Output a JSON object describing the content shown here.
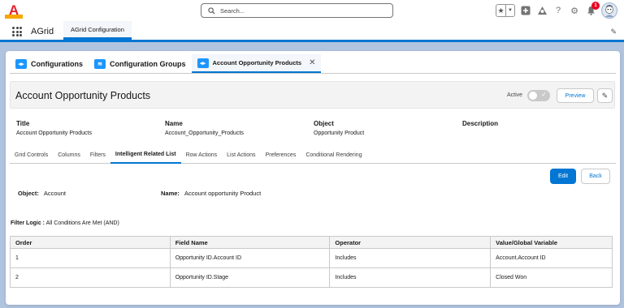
{
  "header": {
    "logo_letter": "A",
    "search_placeholder": "Search...",
    "notification_count": "1"
  },
  "app_nav": {
    "app_name": "AGrid",
    "tab_label": "AGrid Configuration"
  },
  "sub_tabs": [
    {
      "label": "Configurations",
      "icon": "configurations-icon"
    },
    {
      "label": "Configuration Groups",
      "icon": "layers-icon"
    },
    {
      "label": "Account Opportunity Products",
      "icon": "configurations-icon",
      "active": true
    }
  ],
  "record": {
    "title": "Account Opportunity Products",
    "active_label": "Active",
    "preview_label": "Preview",
    "fields": [
      {
        "label": "Title",
        "value": "Account Opportunity Products"
      },
      {
        "label": "Name",
        "value": "Account_Opportunity_Products"
      },
      {
        "label": "Object",
        "value": "Opportunity Product"
      },
      {
        "label": "Description",
        "value": ""
      }
    ]
  },
  "inner_tabs": [
    "Grid Controls",
    "Columns",
    "Filters",
    "Intelligent Related List",
    "Row Actions",
    "List Actions",
    "Preferences",
    "Conditional Rendering"
  ],
  "inner_tab_active": "Intelligent Related List",
  "actions": {
    "edit": "Edit",
    "back": "Back"
  },
  "detail": {
    "object_label": "Object:",
    "object_value": "Account",
    "name_label": "Name:",
    "name_value": "Account opportunity Product"
  },
  "filter_logic": {
    "label": "Filter Logic :",
    "value": "All Conditions Are Met (AND)"
  },
  "table": {
    "headers": [
      "Order",
      "Field Name",
      "Operator",
      "Value/Global Variable"
    ],
    "rows": [
      [
        "1",
        "Opportunity ID.Account ID",
        "Includes",
        "Account.Account ID"
      ],
      [
        "2",
        "Opportunity ID.Stage",
        "Includes",
        "Closed Won"
      ]
    ]
  },
  "colors": {
    "brand": "#0176d3",
    "logo_red": "#e8202a",
    "logo_bg": "#f7a600"
  }
}
